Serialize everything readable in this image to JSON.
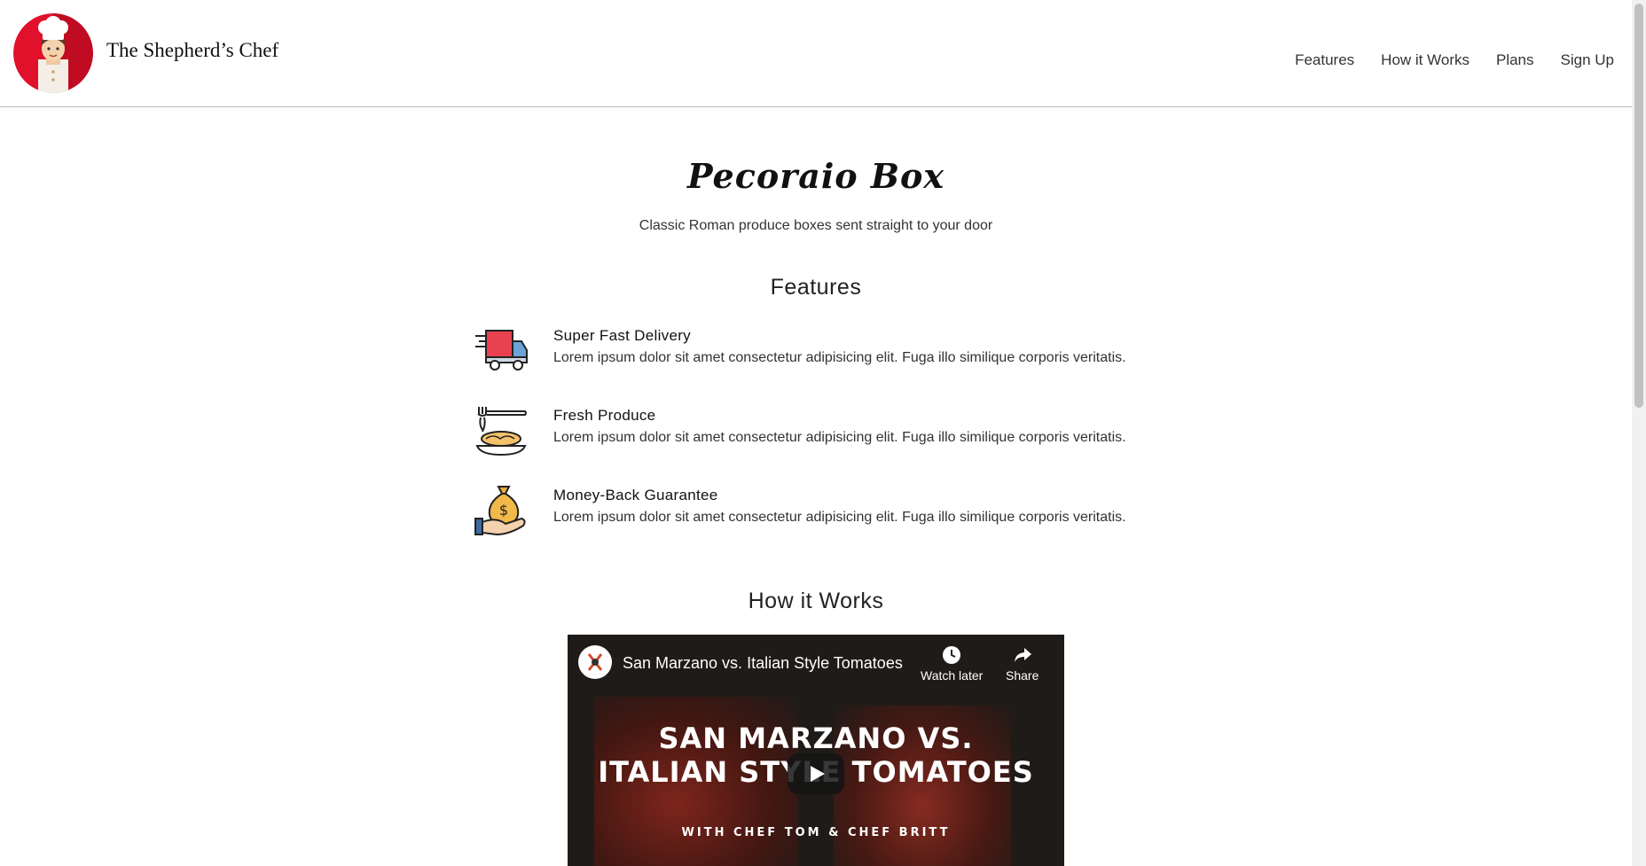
{
  "header": {
    "brand": "The Shepherd’s Chef",
    "nav": [
      "Features",
      "How it Works",
      "Plans",
      "Sign Up"
    ]
  },
  "hero": {
    "title": "Pecoraio Box",
    "subtitle": "Classic Roman produce boxes sent straight to your door"
  },
  "features": {
    "title": "Features",
    "items": [
      {
        "name": "Super Fast Delivery",
        "description": "Lorem ipsum dolor sit amet consectetur adipisicing elit. Fuga illo similique corporis veritatis.",
        "icon": "delivery-truck-icon"
      },
      {
        "name": "Fresh Produce",
        "description": "Lorem ipsum dolor sit amet consectetur adipisicing elit. Fuga illo similique corporis veritatis.",
        "icon": "pasta-fork-icon"
      },
      {
        "name": "Money-Back Guarantee",
        "description": "Lorem ipsum dolor sit amet consectetur adipisicing elit. Fuga illo similique corporis veritatis.",
        "icon": "money-bag-hand-icon"
      }
    ]
  },
  "how_it_works": {
    "title": "How it Works",
    "video": {
      "title": "San Marzano vs. Italian Style Tomatoes",
      "watch_later": "Watch later",
      "share": "Share",
      "overlay_line1": "SAN MARZANO VS.",
      "overlay_line2": "ITALIAN STYLE TOMATOES",
      "overlay_credit": "WITH CHEF TOM & CHEF BRITT"
    }
  },
  "colors": {
    "logo_red": "#e1102b",
    "truck_red": "#e8414f",
    "text_dark": "#222222"
  }
}
